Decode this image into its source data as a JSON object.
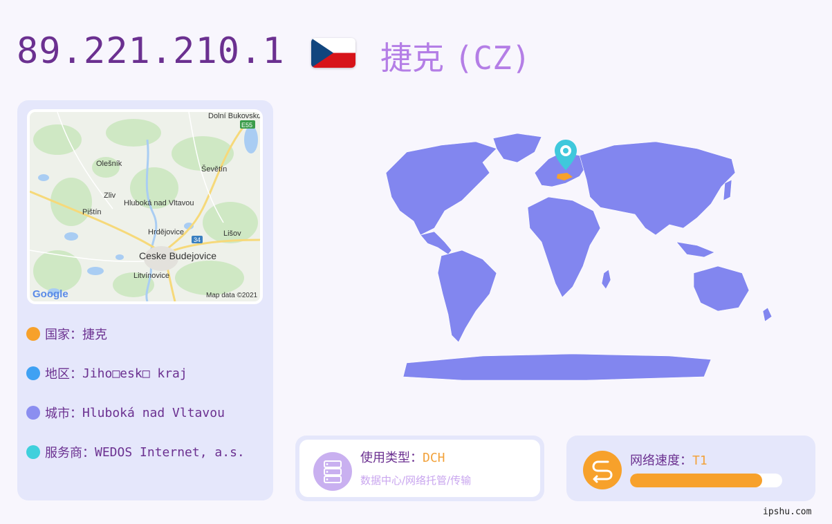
{
  "header": {
    "ip": "89.221.210.1",
    "country_name": "捷克",
    "country_code": "(CZ)"
  },
  "map": {
    "labels": [
      "Dolní Bukovsko",
      "E55",
      "Olešník",
      "Ševětín",
      "Zliv",
      "Hluboká nad Vltavou",
      "Pištín",
      "Hrdějovice",
      "34",
      "Lišov",
      "Ceske Budejovice",
      "Litvínovice"
    ],
    "logo": "Google",
    "attribution": "Map data ©2021"
  },
  "info": {
    "country": {
      "label": "国家：",
      "value": "捷克",
      "color": "#f7a12b"
    },
    "region": {
      "label": "地区：",
      "value": "Jiho□esk□ kraj",
      "color": "#3fa1f3"
    },
    "city": {
      "label": "城市：",
      "value": "Hluboká nad Vltavou",
      "color": "#8b8ef0"
    },
    "isp": {
      "label": "服务商：",
      "value": "WEDOS Internet, a.s.",
      "color": "#3fd0dc"
    }
  },
  "usage": {
    "label": "使用类型：",
    "value": "DCH",
    "description": "数据中心/网络托管/传输",
    "icon": "server-icon"
  },
  "speed": {
    "label": "网络速度：",
    "value": "T1",
    "level": 0.87,
    "icon": "speed-icon"
  },
  "colors": {
    "accent_purple": "#6b3090",
    "map_fill": "#8286ef",
    "highlight": "#f7a12b",
    "pin": "#3fc8dc"
  },
  "watermark": "ipshu.com"
}
